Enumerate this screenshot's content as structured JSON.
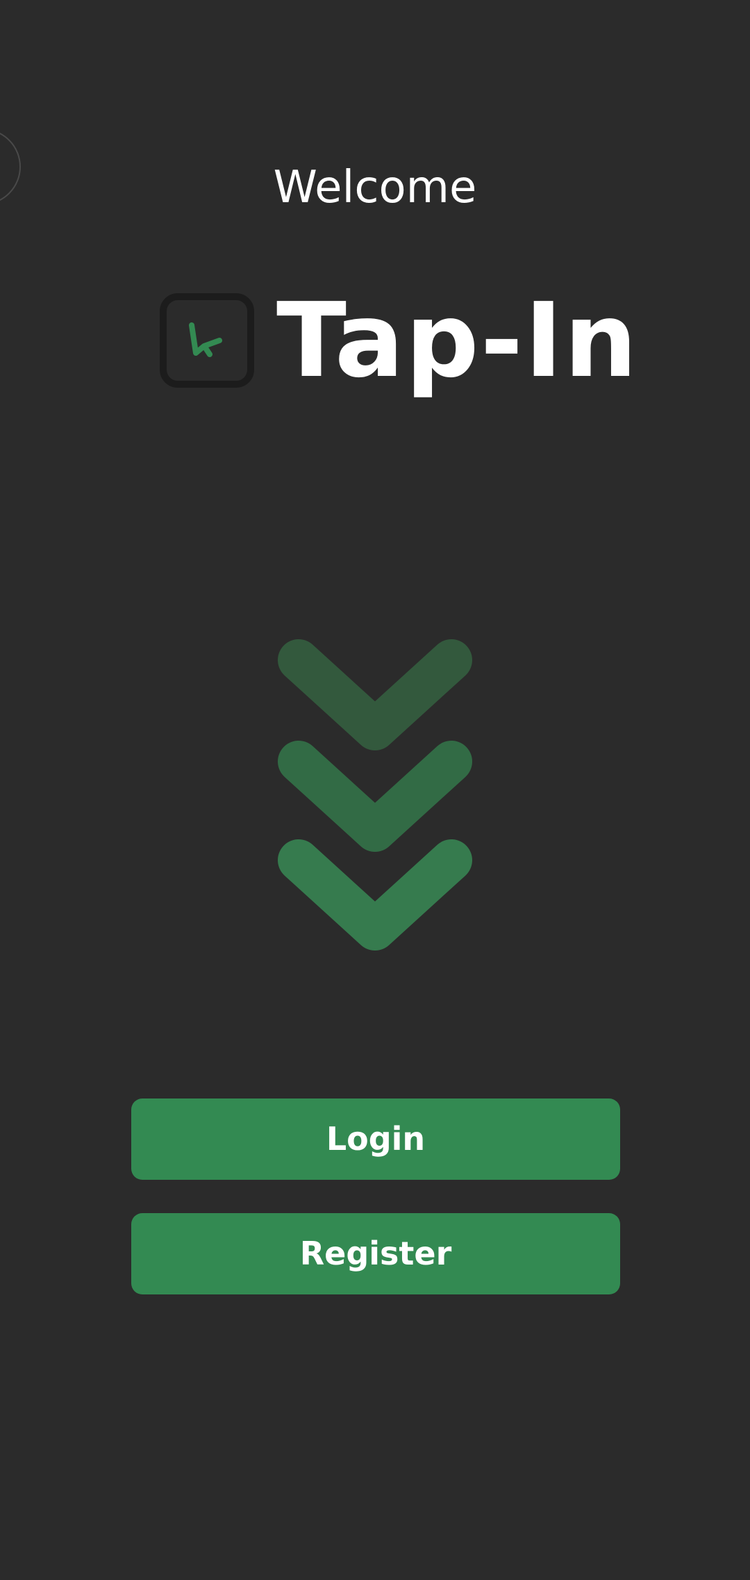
{
  "screen": {
    "welcome_text": "Welcome",
    "brand_name": "Tap-In",
    "logo_icon": "cursor-pointer-icon",
    "decorative_icon": "triple-chevron-down-icon",
    "buttons": {
      "login_label": "Login",
      "register_label": "Register"
    }
  },
  "colors": {
    "background": "#2b2b2b",
    "accent_green": "#338a52",
    "chevron_green_1": "#33593d",
    "chevron_green_2": "#326b45",
    "chevron_green_3": "#367b4e",
    "logo_border": "#1c1c1c",
    "text": "#ffffff"
  }
}
